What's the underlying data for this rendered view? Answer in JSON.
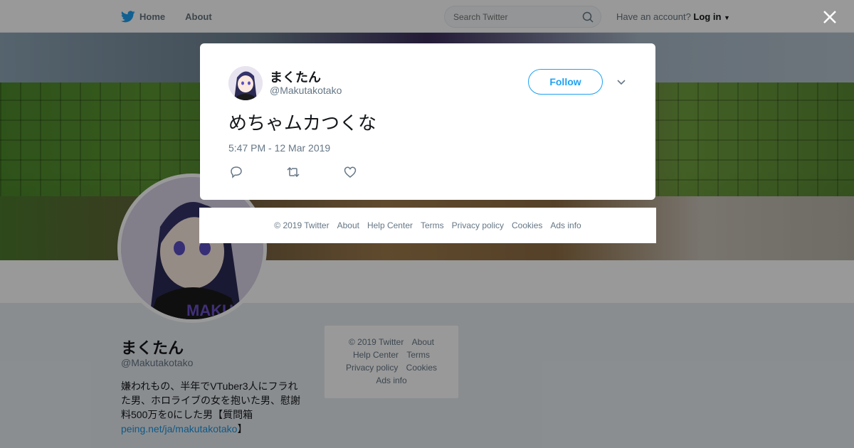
{
  "topbar": {
    "nav": [
      {
        "label": "Home",
        "icon": "twitter-bird-icon"
      },
      {
        "label": "About"
      }
    ],
    "search_placeholder": "Search Twitter",
    "account_prompt": "Have an account?",
    "login_label": "Log in"
  },
  "profile": {
    "name": "まくたん",
    "handle": "@Makutakotako",
    "bio_text": "嫌われもの、半年でVTuber3人にフラれた男、ホロライブの女を抱いた男、慰謝料500万を0にした男【質問箱",
    "bio_link": "peing.net/ja/makutakotako",
    "bio_end": "】",
    "avatar_shirt_text": "MAKU"
  },
  "side_footer": {
    "copyright": "© 2019 Twitter",
    "links": [
      "About",
      "Help Center",
      "Terms",
      "Privacy policy",
      "Cookies",
      "Ads info"
    ]
  },
  "tweet": {
    "author_name": "まくたん",
    "author_handle": "@Makutakotako",
    "follow_label": "Follow",
    "text": "めちゃムカつくな",
    "timestamp": "5:47 PM - 12 Mar 2019",
    "actions": [
      "reply-icon",
      "retweet-icon",
      "like-icon"
    ]
  },
  "modal_footer": {
    "copyright": "© 2019 Twitter",
    "links": [
      "About",
      "Help Center",
      "Terms",
      "Privacy policy",
      "Cookies",
      "Ads info"
    ]
  },
  "colors": {
    "accent": "#1da1f2",
    "text_primary": "#14171a",
    "text_secondary": "#657786",
    "page_bg": "#e6ecf0"
  }
}
